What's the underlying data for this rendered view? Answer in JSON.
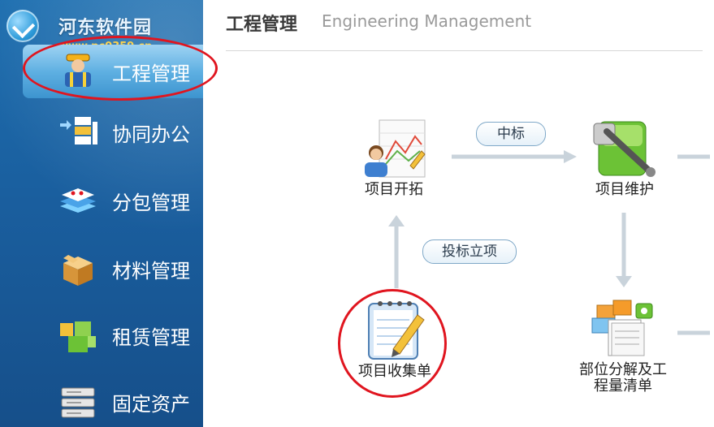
{
  "watermark": {
    "site_name": "河东软件园",
    "url": "www.pc0359.cn"
  },
  "sidebar": {
    "items": [
      {
        "label": "工程管理",
        "icon": "worker-icon",
        "active": true
      },
      {
        "label": "协同办公",
        "icon": "collaboration-icon"
      },
      {
        "label": "分包管理",
        "icon": "layers-icon"
      },
      {
        "label": "材料管理",
        "icon": "box-icon"
      },
      {
        "label": "租赁管理",
        "icon": "cubes-icon"
      },
      {
        "label": "固定资产",
        "icon": "server-icon"
      }
    ]
  },
  "header": {
    "title": "工程管理",
    "subtitle": "Engineering Management"
  },
  "flow": {
    "nodes": {
      "project_expand": "项目开拓",
      "project_maintain": "项目维护",
      "project_collect": "项目收集单",
      "part_breakdown_line1": "部位分解及工",
      "part_breakdown_line2": "程量清单"
    },
    "labels": {
      "win_bid": "中标",
      "bid_setup": "投标立项"
    }
  },
  "colors": {
    "sidebar_blue": "#1a5f9f",
    "highlight_red": "#e0151f",
    "arrow": "#c9d3db"
  }
}
